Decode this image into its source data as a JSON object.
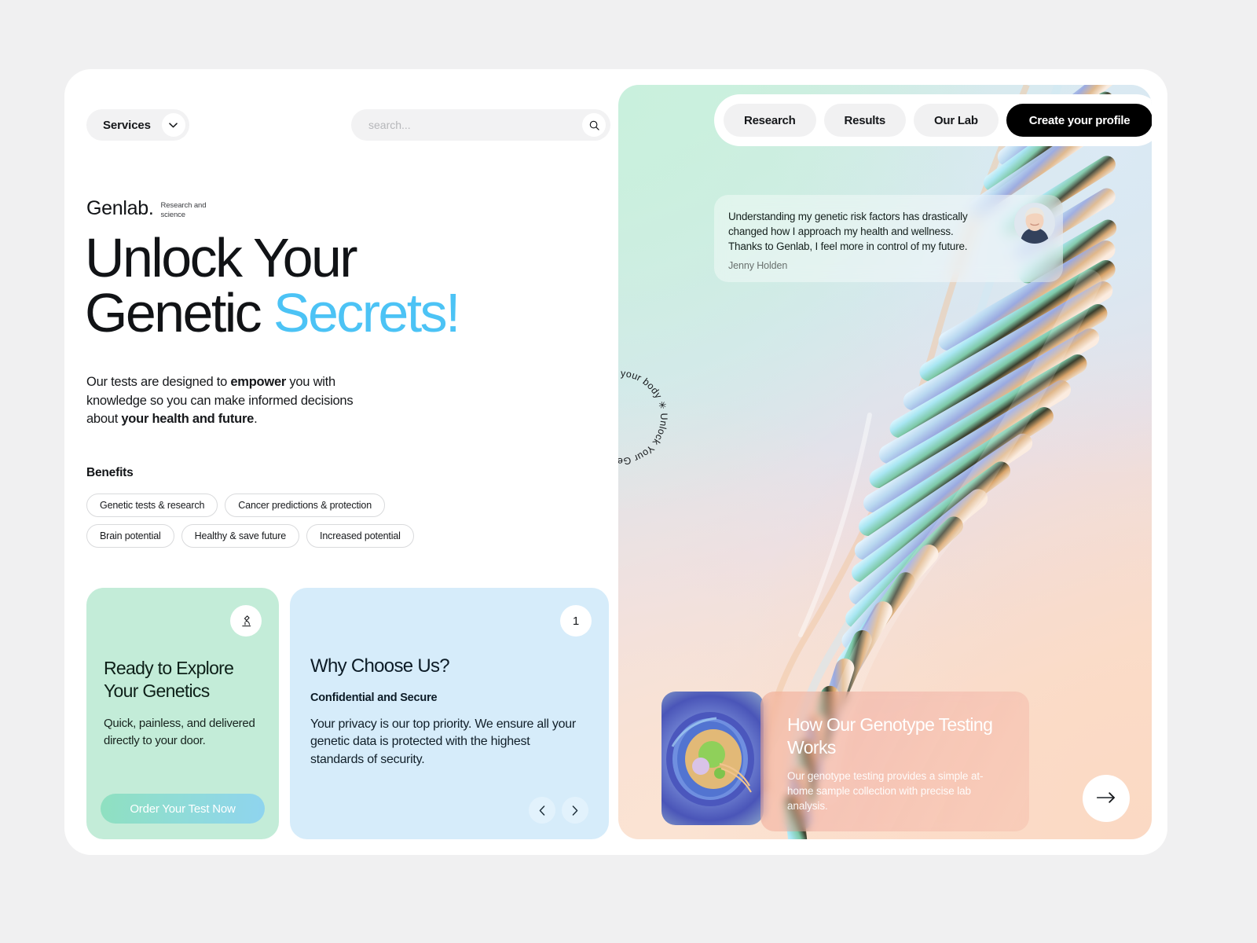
{
  "topbar": {
    "services_label": "Services",
    "services_icon": "chevron-down-icon",
    "search_placeholder": "search...",
    "search_value": "",
    "search_icon": "search-icon"
  },
  "brand": {
    "name": "Genlab.",
    "tagline": "Research and science"
  },
  "hero": {
    "headline_line1": "Unlock Your",
    "headline_line2a": "Genetic ",
    "headline_line2b": "Secrets!",
    "accent_color": "#4cc3f5",
    "lede_part1": "Our tests are designed to ",
    "lede_bold1": "empower",
    "lede_part2": " you with knowledge so you can make informed decisions about ",
    "lede_bold2": "your health and future",
    "lede_part3": "."
  },
  "benefits": {
    "title": "Benefits",
    "tags": [
      "Genetic tests & research",
      "Cancer predictions & protection",
      "Brain potential",
      "Healthy & save future",
      "Increased potential"
    ]
  },
  "green_card": {
    "icon": "microscope-icon",
    "title": "Ready to Explore Your Genetics",
    "body": "Quick, painless, and delivered directly to your door.",
    "button_label": "Order Your Test Now",
    "bg_color": "#c3ecd8"
  },
  "blue_card": {
    "badge": "1",
    "title": "Why Choose Us?",
    "subtitle": "Confidential and Secure",
    "body": "Your privacy is our top priority. We ensure all your genetic data is protected with the highest standards of security.",
    "prev_icon": "chevron-left-icon",
    "next_icon": "chevron-right-icon",
    "bg_color": "#d6ecfa"
  },
  "right_nav": {
    "items": [
      "Research",
      "Results",
      "Our Lab"
    ],
    "cta_label": "Create your profile"
  },
  "testimonial": {
    "quote": "Understanding my genetic risk factors has drastically changed how I approach my health and wellness. Thanks to Genlab, I feel more in control of my future.",
    "author": "Jenny Holden",
    "avatar": "avatar-photo"
  },
  "circle_badge": {
    "text": "✳ Decode your body ✳ Unlock Your Genetic Secrets!"
  },
  "genotype_card": {
    "thumb": "cell-illustration",
    "title": "How Our Genotype Testing Works",
    "body": "Our genotype testing provides a simple at-home sample collection with precise lab analysis."
  },
  "next_button": {
    "icon": "arrow-right-icon"
  }
}
